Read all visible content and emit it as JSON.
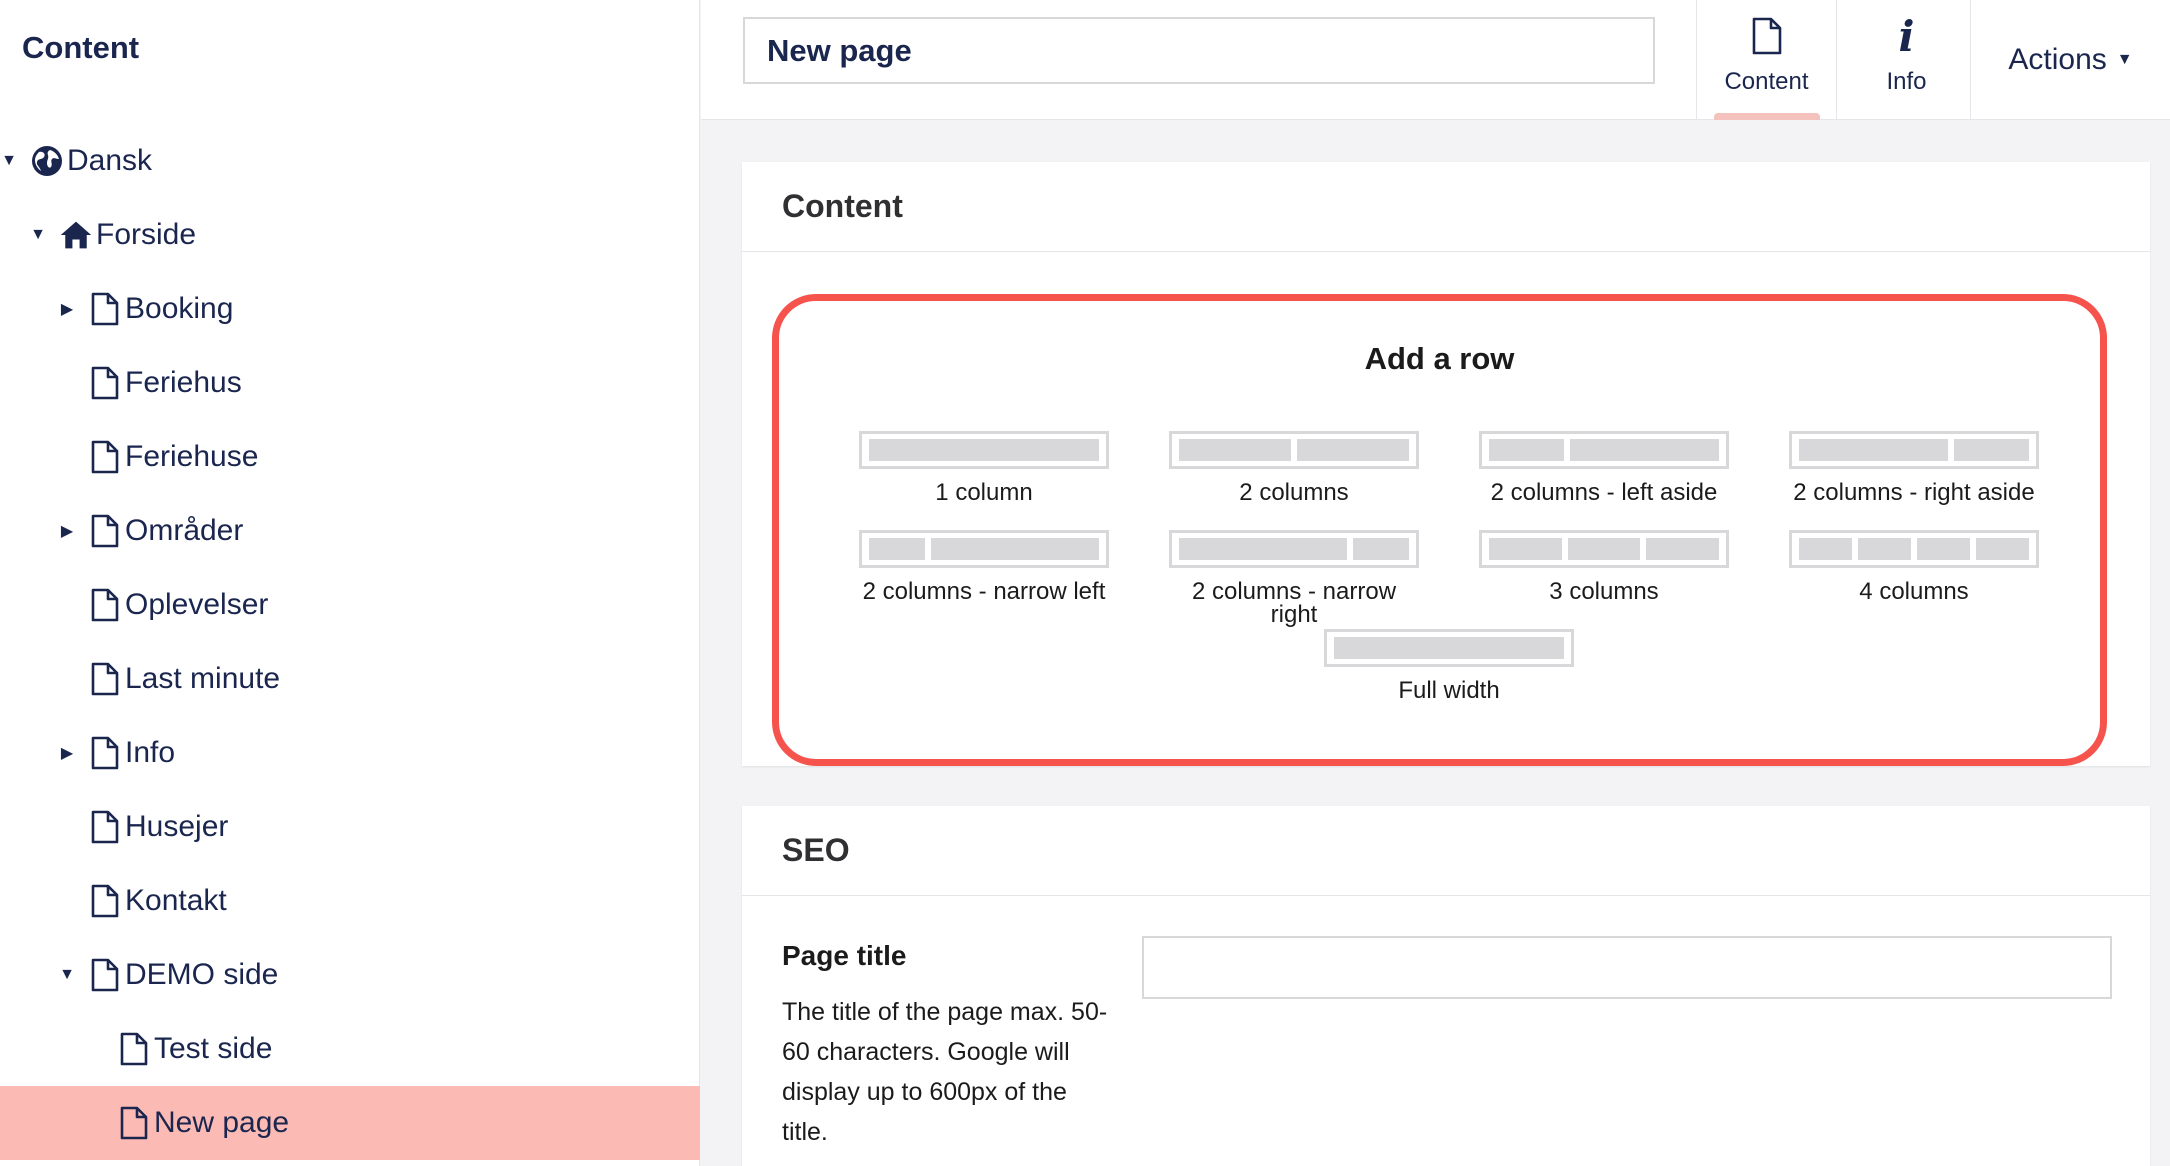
{
  "sidebar": {
    "title": "Content",
    "tree": [
      {
        "label": "Dansk",
        "icon": "globe-icon",
        "caret": "expanded"
      },
      {
        "label": "Forside",
        "icon": "home-icon",
        "caret": "expanded"
      },
      {
        "label": "Booking",
        "icon": "document-icon",
        "caret": "collapsed"
      },
      {
        "label": "Feriehus",
        "icon": "document-icon",
        "caret": "none"
      },
      {
        "label": "Feriehuse",
        "icon": "document-icon",
        "caret": "none"
      },
      {
        "label": "Områder",
        "icon": "document-icon",
        "caret": "collapsed"
      },
      {
        "label": "Oplevelser",
        "icon": "document-icon",
        "caret": "none"
      },
      {
        "label": "Last minute",
        "icon": "document-icon",
        "caret": "none"
      },
      {
        "label": "Info",
        "icon": "document-icon",
        "caret": "collapsed"
      },
      {
        "label": "Husejer",
        "icon": "document-icon",
        "caret": "none"
      },
      {
        "label": "Kontakt",
        "icon": "document-icon",
        "caret": "none"
      },
      {
        "label": "DEMO side",
        "icon": "document-icon",
        "caret": "expanded"
      },
      {
        "label": "Test side",
        "icon": "document-icon",
        "caret": "none"
      },
      {
        "label": "New page",
        "icon": "document-icon",
        "caret": "none",
        "selected": true
      }
    ]
  },
  "header": {
    "page_name": "New page",
    "tabs": [
      {
        "label": "Content",
        "icon": "document-icon",
        "active": true
      },
      {
        "label": "Info",
        "icon": "info-icon",
        "active": false
      }
    ],
    "actions_label": "Actions"
  },
  "content_panel": {
    "title": "Content",
    "add_row_title": "Add a row",
    "layouts": [
      {
        "label": "1 column",
        "columns": [
          1
        ]
      },
      {
        "label": "2 columns",
        "columns": [
          1,
          1
        ]
      },
      {
        "label": "2 columns - left aside",
        "columns": [
          1,
          2
        ]
      },
      {
        "label": "2 columns - right aside",
        "columns": [
          2,
          1
        ]
      },
      {
        "label": "2 columns - narrow left",
        "columns": [
          1,
          3
        ]
      },
      {
        "label": "2 columns - narrow right",
        "columns": [
          3,
          1
        ]
      },
      {
        "label": "3 columns",
        "columns": [
          1,
          1,
          1
        ]
      },
      {
        "label": "4 columns",
        "columns": [
          1,
          1,
          1,
          1
        ]
      },
      {
        "label": "Full width",
        "columns": [
          1
        ]
      }
    ]
  },
  "seo_panel": {
    "title": "SEO",
    "page_title_label": "Page title",
    "page_title_description": "The title of the page max. 50-60 characters. Google will display up to 600px of the title.",
    "page_title_value": ""
  },
  "colors": {
    "primary_text": "#1b264f",
    "selected_row": "#fcbab4",
    "highlight_border": "#f5534b",
    "active_tab_indicator": "#f5c1bc"
  }
}
